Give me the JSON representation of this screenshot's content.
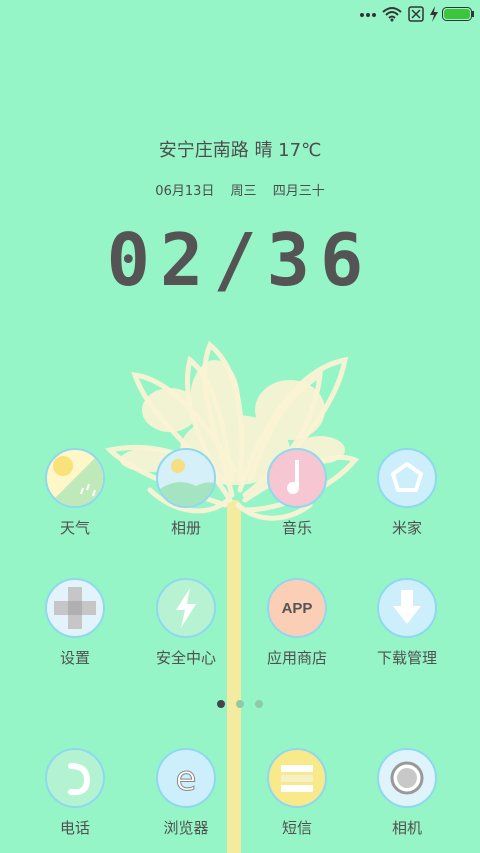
{
  "status_bar": {
    "icons": [
      "more-dots-icon",
      "wifi-icon",
      "sim-no-signal-icon",
      "charging-icon",
      "battery-icon"
    ],
    "battery_color": "#3ec53e"
  },
  "lockscreen": {
    "weather": "安宁庄南路 晴 17℃",
    "date": "06月13日",
    "weekday": "周三",
    "lunar": "四月三十",
    "time": "02/36"
  },
  "apps_row1": [
    {
      "label": "天气",
      "icon": "weather-icon"
    },
    {
      "label": "相册",
      "icon": "gallery-icon"
    },
    {
      "label": "音乐",
      "icon": "music-icon"
    },
    {
      "label": "米家",
      "icon": "mijia-icon"
    }
  ],
  "apps_row2": [
    {
      "label": "设置",
      "icon": "settings-icon"
    },
    {
      "label": "安全中心",
      "icon": "security-icon"
    },
    {
      "label": "应用商店",
      "icon": "app-store-icon",
      "badge_text": "APP"
    },
    {
      "label": "下载管理",
      "icon": "download-icon"
    }
  ],
  "page_indicator": {
    "count": 3,
    "active": 1
  },
  "dock": [
    {
      "label": "电话",
      "icon": "phone-icon"
    },
    {
      "label": "浏览器",
      "icon": "browser-icon"
    },
    {
      "label": "短信",
      "icon": "messages-icon"
    },
    {
      "label": "相机",
      "icon": "camera-icon"
    }
  ],
  "colors": {
    "background": "#96f5c6",
    "icon_border": "#8ed8f0",
    "text": "#4d4d4d"
  }
}
